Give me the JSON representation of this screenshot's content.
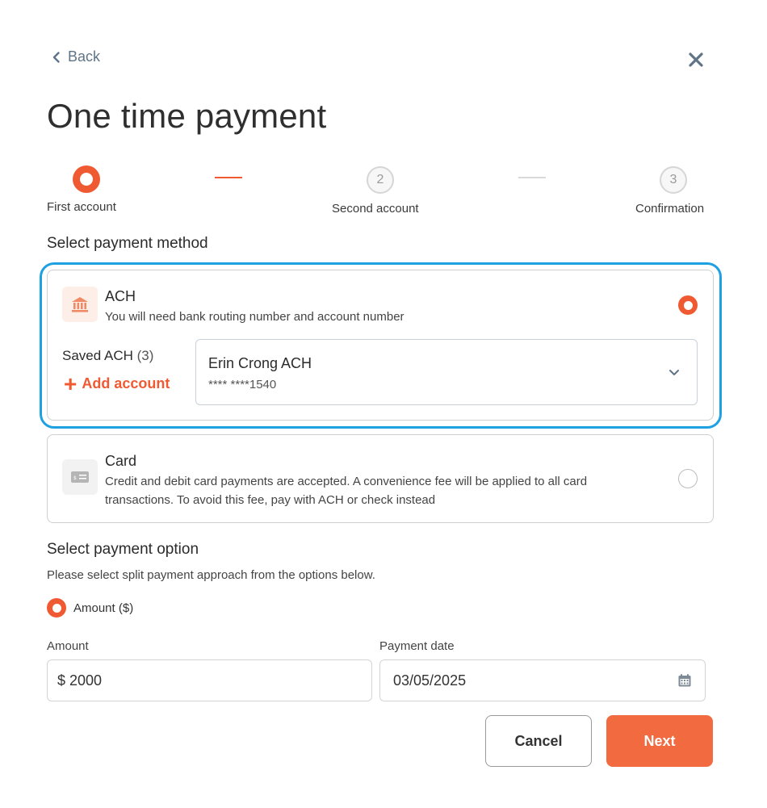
{
  "nav": {
    "back_label": "Back"
  },
  "page": {
    "title": "One time payment"
  },
  "stepper": {
    "steps": [
      {
        "label": "First account",
        "number": "1",
        "state": "active"
      },
      {
        "label": "Second account",
        "number": "2",
        "state": "pending"
      },
      {
        "label": "Confirmation",
        "number": "3",
        "state": "pending"
      }
    ]
  },
  "payment_method": {
    "heading": "Select payment method",
    "ach": {
      "name": "ACH",
      "description": "You will need bank routing number and account number",
      "selected": true,
      "saved_label": "Saved ACH",
      "saved_count": "(3)",
      "add_account_label": "Add account",
      "selected_account": {
        "name": "Erin Crong ACH",
        "number": "**** ****1540"
      }
    },
    "card": {
      "name": "Card",
      "description_line1": "Credit and debit card payments are accepted. A  convenience fee will be applied to all card",
      "description_line2": "transactions. To avoid this fee, pay with ACH or check instead",
      "selected": false
    }
  },
  "payment_option": {
    "heading": "Select payment option",
    "description": "Please select split payment approach from the options below.",
    "option_label": "Amount ($)",
    "amount_label": "Amount",
    "amount_value": "$ 2000",
    "date_label": "Payment date",
    "date_value": "03/05/2025"
  },
  "actions": {
    "cancel_label": "Cancel",
    "next_label": "Next"
  },
  "colors": {
    "accent": "#f05a33",
    "focus": "#1ea1e0",
    "muted": "#5f7487"
  }
}
